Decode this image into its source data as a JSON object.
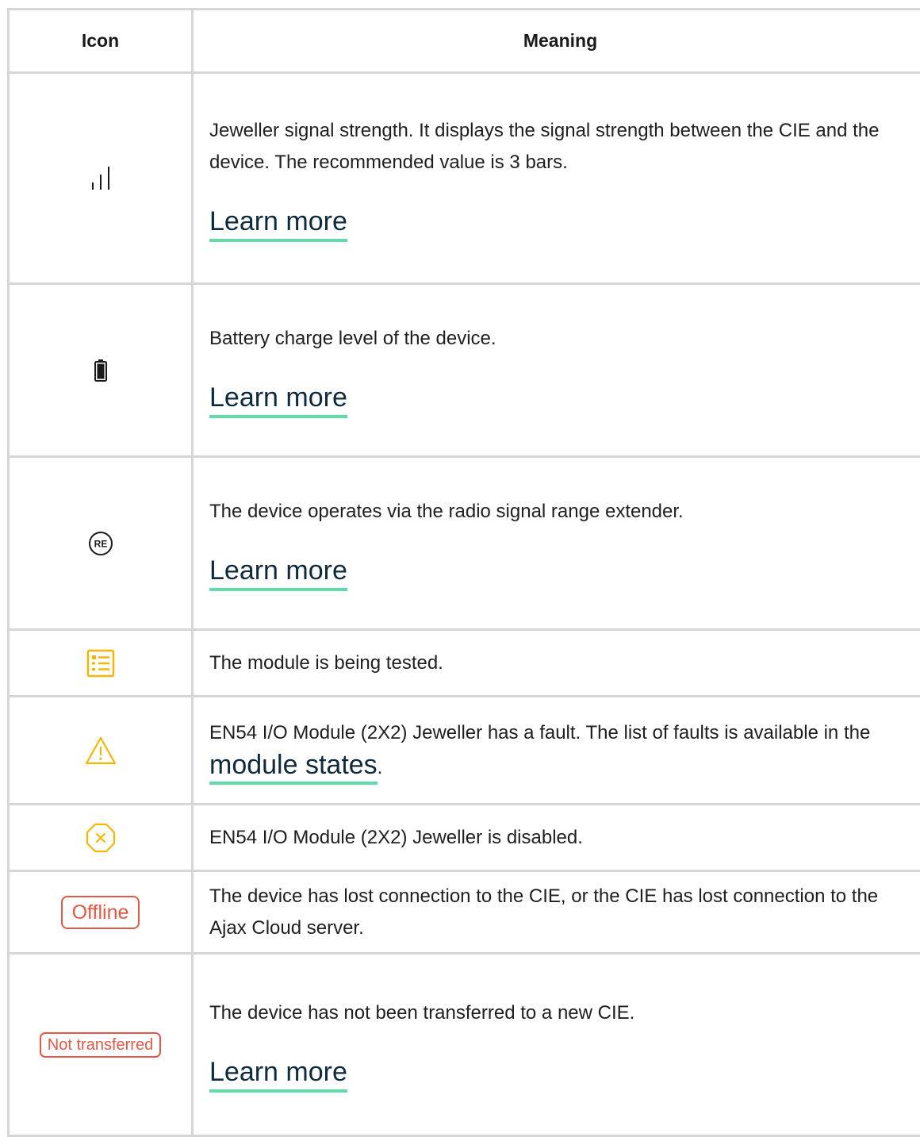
{
  "table": {
    "header_icon": "Icon",
    "header_meaning": "Meaning"
  },
  "rows": [
    {
      "icon": "signal-strength-icon",
      "description": "Jeweller signal strength. It displays the signal strength between the CIE and the device. The recommended value is 3 bars.",
      "link": "Learn more"
    },
    {
      "icon": "battery-icon",
      "description": "Battery charge level of the device.",
      "link": "Learn more"
    },
    {
      "icon": "range-extender-icon",
      "icon_text": "RE",
      "description": "The device operates via the radio signal range extender.",
      "link": "Learn more"
    },
    {
      "icon": "test-list-icon",
      "description": "The module is being tested."
    },
    {
      "icon": "warning-icon",
      "description_before": "EN54 I/O Module (2X2) Jeweller has a fault. The list of faults is available in the ",
      "link": "module states",
      "description_after": "."
    },
    {
      "icon": "disabled-icon",
      "description": "EN54 I/O Module (2X2) Jeweller is disabled."
    },
    {
      "icon": "offline-badge",
      "badge": "Offline",
      "description": "The device has lost connection to the CIE, or the CIE has lost connection to the Ajax Cloud server."
    },
    {
      "icon": "not-transferred-badge",
      "badge": "Not transferred",
      "description": "The device has not been transferred to a new CIE.",
      "link": "Learn more"
    }
  ],
  "colors": {
    "border": "#d6d6d6",
    "link_underline": "#5ddcaa",
    "warning_yellow": "#f2b705",
    "error_red": "#e25846"
  }
}
